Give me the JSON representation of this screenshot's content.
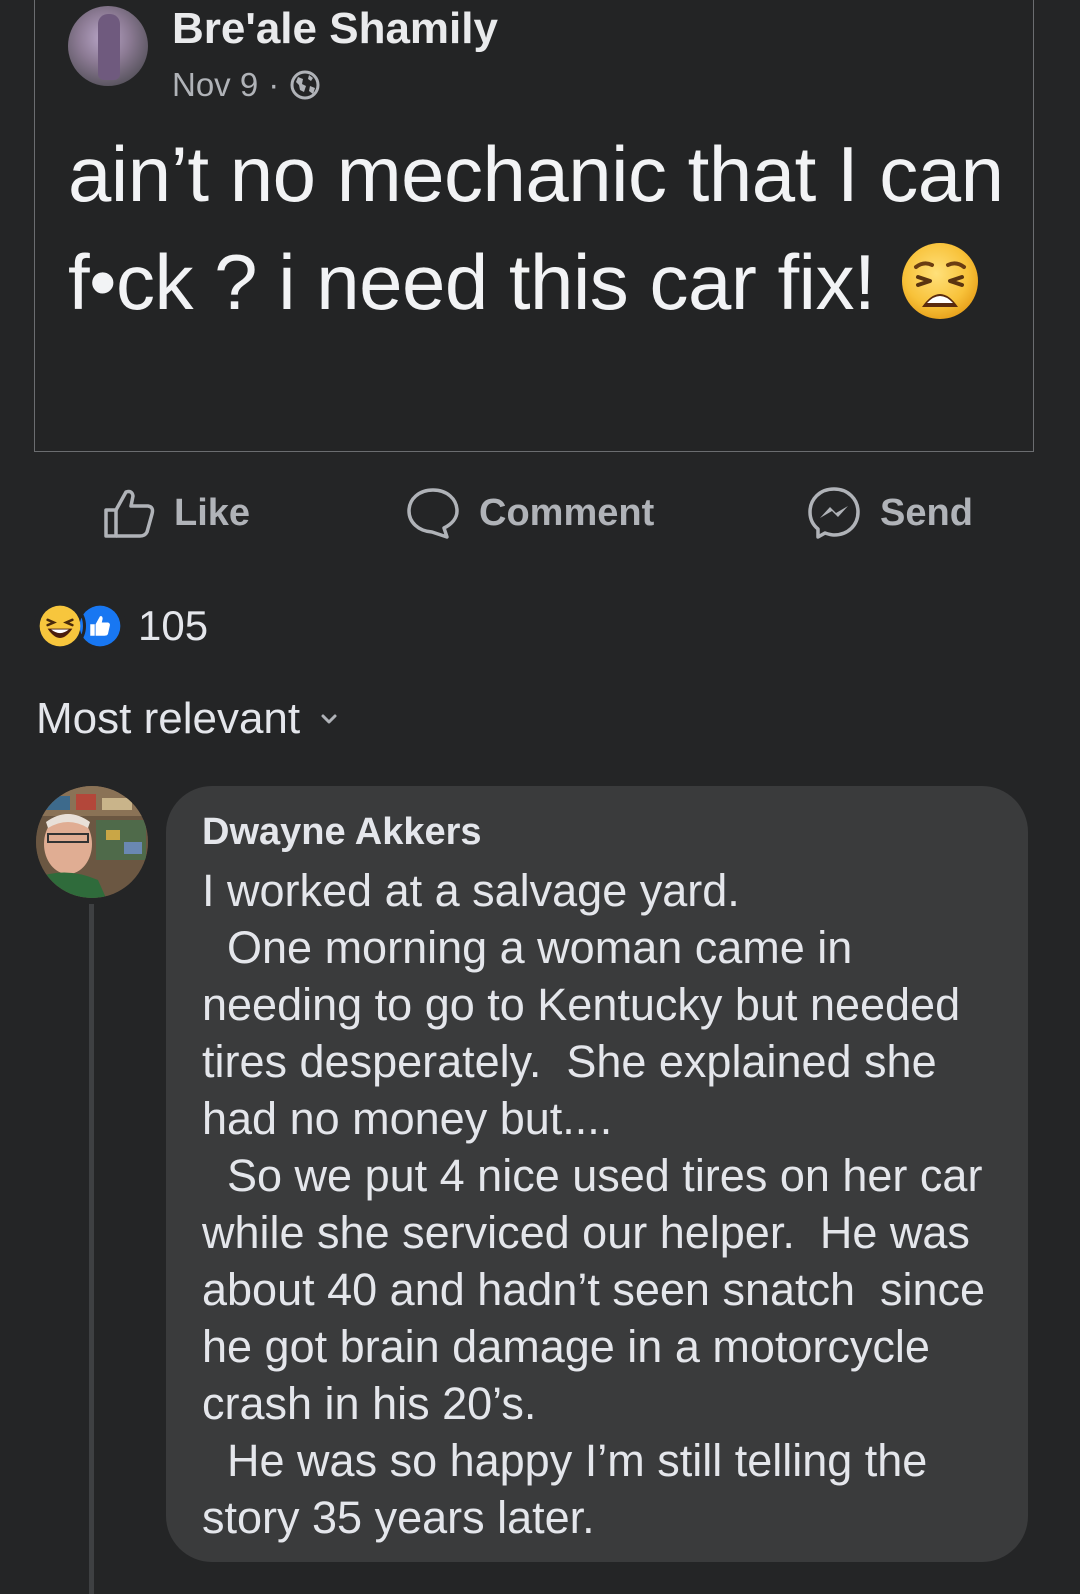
{
  "post": {
    "author": "Bre'ale Shamily",
    "date": "Nov 9",
    "separator": "·",
    "privacy_icon": "globe-icon",
    "text": "ain’t no mechanic that I can f•ck ? i need this car fix!",
    "emoji": "weary-face"
  },
  "actions": {
    "like_label": "Like",
    "comment_label": "Comment",
    "send_label": "Send"
  },
  "reactions": {
    "icons": [
      "haha-icon",
      "like-icon"
    ],
    "count": "105"
  },
  "comments_sort": {
    "label": "Most relevant",
    "icon": "chevron-down-icon"
  },
  "comment": {
    "author": "Dwayne Akkers",
    "text": "I worked at a salvage yard.\n  One morning a woman came in needing to go to Kentucky but needed tires desperately.  She explained she had no money but....\n  So we put 4 nice used tires on her car while she serviced our helper.  He was about 40 and hadn’t seen snatch  since he got brain damage in a motorcycle crash in his 20’s.\n  He was so happy I’m still telling the story 35 years later."
  },
  "colors": {
    "background": "#242526",
    "comment_bubble": "#3a3b3c",
    "secondary_text": "#b0b3b8",
    "like_blue": "#1877f2"
  }
}
